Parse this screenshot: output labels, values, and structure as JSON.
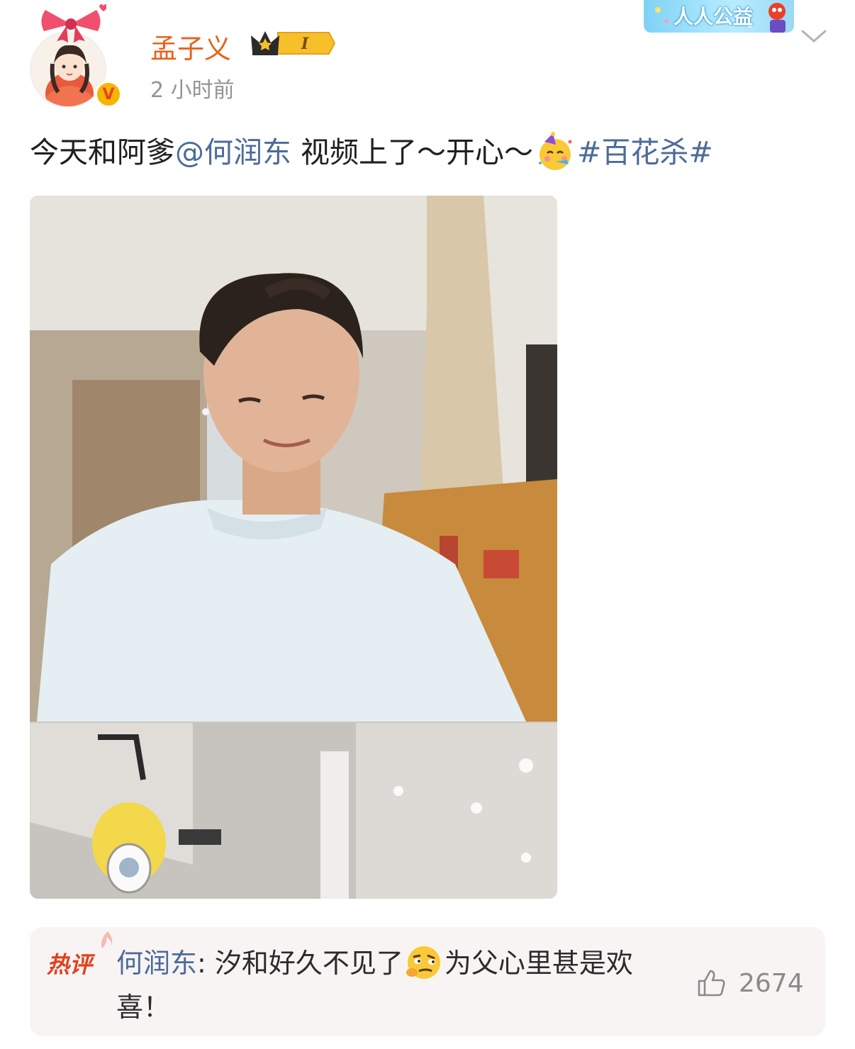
{
  "post": {
    "author": "孟子义",
    "vip_level": "I",
    "timestamp": "2 小时前",
    "charity_badge": "人人公益",
    "text_prefix": "今天和阿爹",
    "mention": "@何润东",
    "text_middle": " 视频上了～开心～",
    "emoji": "partying-face-emoji",
    "hashtag": "#百花杀#"
  },
  "hot_comment": {
    "label": "热评",
    "author": "何润东",
    "separator": ": ",
    "text_before": "汐和好久不见了",
    "emoji": "smirk-face-emoji",
    "text_after": "为父心里甚是欢喜！",
    "likes": "2674"
  },
  "colors": {
    "username": "#e8621c",
    "link": "#4c6b9a",
    "timestamp": "#939393",
    "hot_label": "#e0411e",
    "comment_bg": "#f8f4f4"
  }
}
